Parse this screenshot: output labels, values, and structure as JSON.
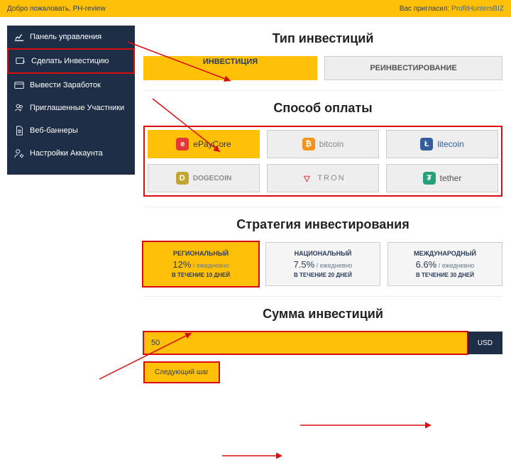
{
  "topbar": {
    "welcome": "Добро пожаловать, PH-review",
    "invited_label": "Вас пригласил:",
    "inviter": "ProfitHuntersBIZ"
  },
  "sidebar": {
    "items": [
      {
        "label": "Панель управления"
      },
      {
        "label": "Сделать Инвестицию"
      },
      {
        "label": "Вывести Заработок"
      },
      {
        "label": "Приглашенные Участники"
      },
      {
        "label": "Веб-баннеры"
      },
      {
        "label": "Настройки Аккаунта"
      }
    ]
  },
  "invest_type": {
    "title": "Тип инвестиций",
    "tabs": [
      {
        "label": "ИНВЕСТИЦИЯ"
      },
      {
        "label": "РЕИНВЕСТИРОВАНИЕ"
      }
    ]
  },
  "payment": {
    "title": "Способ оплаты",
    "options": [
      {
        "label": "ePayCore",
        "logo_bg": "#e53737",
        "logo_txt": "e",
        "text_color": "#333"
      },
      {
        "label": "bitcoin",
        "logo_bg": "#f7931a",
        "logo_txt": "₿",
        "text_color": "#8a8a8a"
      },
      {
        "label": "litecoin",
        "logo_bg": "#345d9d",
        "logo_txt": "Ł",
        "text_color": "#345d9d"
      },
      {
        "label": "DOGECOIN",
        "logo_bg": "#c2a633",
        "logo_txt": "D",
        "text_color": "#8a8a8a"
      },
      {
        "label": "TRON",
        "logo_bg": "",
        "logo_txt": "▽",
        "text_color": "#8a8a8a"
      },
      {
        "label": "tether",
        "logo_bg": "#26a17b",
        "logo_txt": "₮",
        "text_color": "#555"
      }
    ]
  },
  "strategy": {
    "title": "Стратегия инвестирования",
    "options": [
      {
        "name": "РЕГИОНАЛЬНЫЙ",
        "rate": "12%",
        "per": " / ежедневно",
        "duration": "В ТЕЧЕНИЕ 10 ДНЕЙ"
      },
      {
        "name": "НАЦИОНАЛЬНЫЙ",
        "rate": "7.5%",
        "per": " / ежедневно",
        "duration": "В ТЕЧЕНИЕ 20 ДНЕЙ"
      },
      {
        "name": "МЕЖДУНАРОДНЫЙ",
        "rate": "6.6%",
        "per": " / ежедневно",
        "duration": "В ТЕЧЕНИЕ 30 ДНЕЙ"
      }
    ]
  },
  "amount": {
    "title": "Сумма инвестиций",
    "value": "50",
    "currency": "USD"
  },
  "next_button": "Следующий шаг"
}
